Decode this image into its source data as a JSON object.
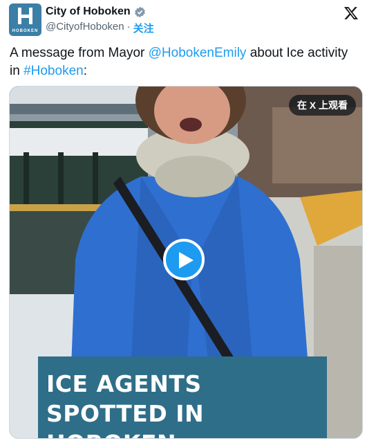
{
  "account": {
    "name": "City of Hoboken",
    "handle": "@CityofHoboken",
    "separator": "·",
    "follow_label": "关注",
    "avatar_wordmark": "HOBOKEN"
  },
  "tweet": {
    "text_before": "A message from Mayor ",
    "mention": "@HobokenEmily",
    "text_middle": " about Ice activity in ",
    "hashtag": "#Hoboken",
    "text_after": ":"
  },
  "video": {
    "watch_on_x_label": "在 X 上观看",
    "caption": "ICE AGENTS SPOTTED IN HOBOKEN"
  },
  "colors": {
    "accent": "#1d9bf0",
    "banner": "#2f6e88",
    "avatar": "#3c7fa6",
    "coat": "#2f6fd0"
  },
  "icons": {
    "verified": "verified-badge-icon",
    "x_logo": "x-logo-icon",
    "play": "play-icon"
  }
}
